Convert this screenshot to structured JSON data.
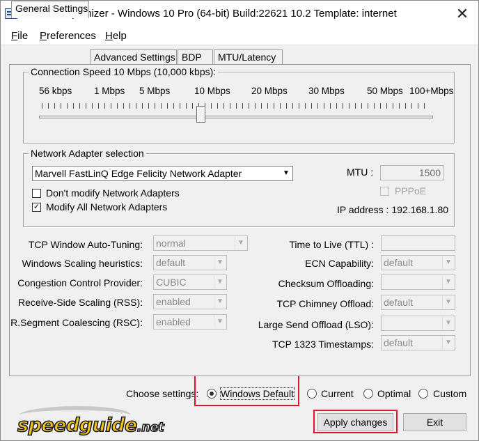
{
  "window": {
    "title": "SG TCP Optimizer - Windows 10 Pro (64-bit) Build:22621 10.2  Template: internet",
    "close_glyph": "✕"
  },
  "menu": {
    "items": [
      {
        "accel": "F",
        "rest": "ile"
      },
      {
        "accel": "P",
        "rest": "references"
      },
      {
        "accel": "H",
        "rest": "elp"
      }
    ]
  },
  "tabs": [
    "General Settings",
    "Advanced Settings",
    "BDP",
    "MTU/Latency"
  ],
  "connection_speed": {
    "label": "Connection Speed  10 Mbps (10,000 kbps):",
    "ticks": [
      "56 kbps",
      "1 Mbps",
      "5 Mbps",
      "10 Mbps",
      "20 Mbps",
      "30 Mbps",
      "50 Mbps",
      "100+Mbps"
    ],
    "slider_value_fraction": 0.41
  },
  "adapter": {
    "group_label": "Network Adapter selection",
    "selected": "Marvell FastLinQ Edge Felicity Network Adapter",
    "dont_modify_label": "Don't modify Network Adapters",
    "dont_modify_checked": false,
    "modify_all_label": "Modify All Network Adapters",
    "modify_all_checked": true,
    "check_mark": "✓",
    "mtu_label": "MTU :",
    "mtu_value": "1500",
    "pppoe_label": "PPPoE",
    "ip_label": "IP address : 192.168.1.80"
  },
  "settings_left": [
    {
      "label": "TCP Window Auto-Tuning:",
      "value": "normal"
    },
    {
      "label": "Windows Scaling heuristics:",
      "value": "default"
    },
    {
      "label": "Congestion Control Provider:",
      "value": "CUBIC"
    },
    {
      "label": "Receive-Side Scaling (RSS):",
      "value": "enabled"
    },
    {
      "label": "R.Segment Coalescing (RSC):",
      "value": "enabled"
    }
  ],
  "settings_right": [
    {
      "label": "Time to Live (TTL) :",
      "value": ""
    },
    {
      "label": "ECN Capability:",
      "value": "default"
    },
    {
      "label": "Checksum Offloading:",
      "value": ""
    },
    {
      "label": "TCP Chimney Offload:",
      "value": "default"
    },
    {
      "label": "Large Send Offload (LSO):",
      "value": ""
    },
    {
      "label": "TCP 1323 Timestamps:",
      "value": "default"
    }
  ],
  "choose_settings": {
    "label": "Choose settings:",
    "options": [
      "Windows Default",
      "Current",
      "Optimal",
      "Custom"
    ],
    "selected": "Windows Default"
  },
  "buttons": {
    "apply": "Apply changes",
    "exit": "Exit"
  },
  "logo": {
    "text": "speedguide",
    "suffix": ".net"
  },
  "colors": {
    "highlight": "#e8112d",
    "logo_yellow": "#f3c31b"
  }
}
